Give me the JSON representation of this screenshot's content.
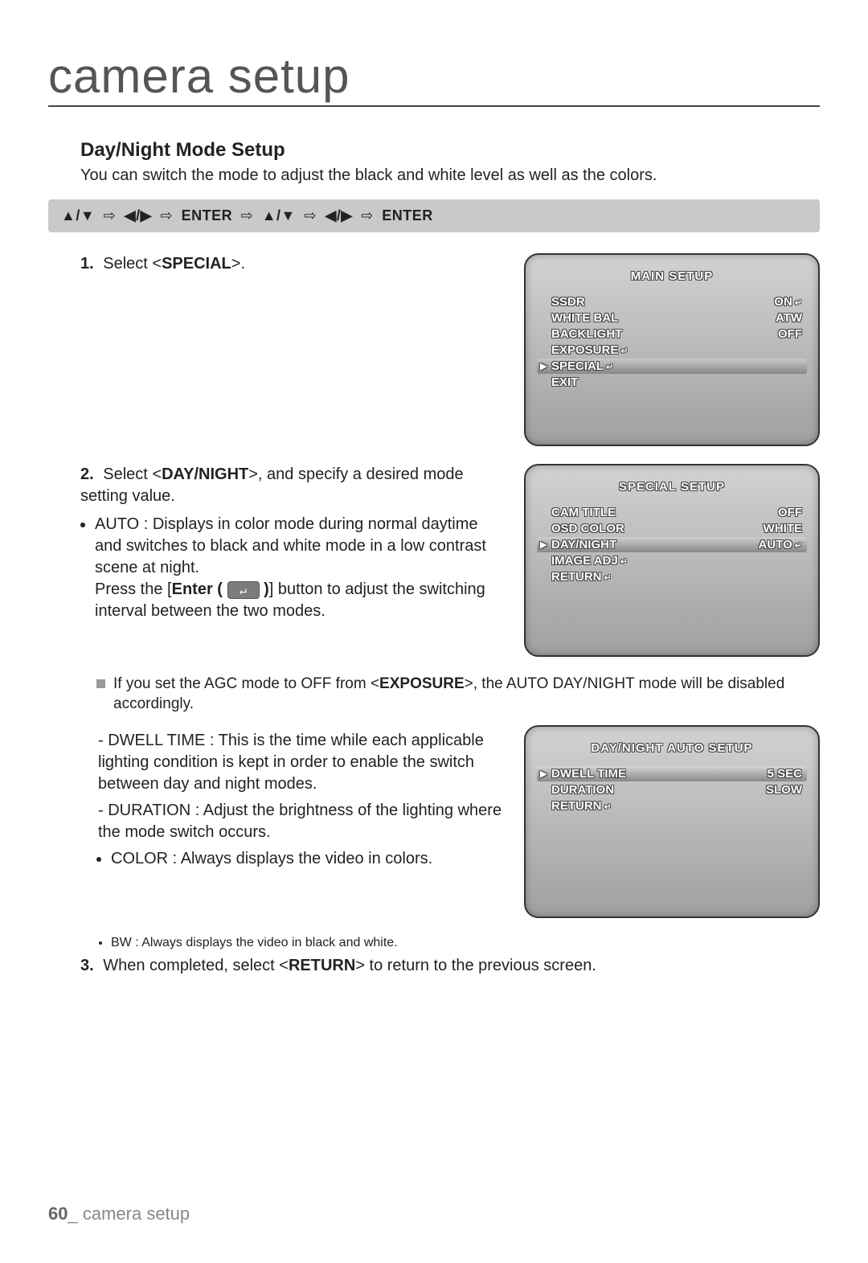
{
  "page_title": "camera setup",
  "heading": "Day/Night Mode Setup",
  "intro": "You can switch the mode to adjust the black and white level as well as the colors.",
  "nav": {
    "seg1": "▲/▼",
    "seg2": "◀/▶",
    "enter": "ENTER",
    "arrow": "⇨"
  },
  "steps": {
    "s1_num": "1.",
    "s1_a": "Select <",
    "s1_b": "SPECIAL",
    "s1_c": ">.",
    "s2_num": "2.",
    "s2_a": "Select <",
    "s2_b": "DAY/NIGHT",
    "s2_c": ">, and specify a desired mode setting value.",
    "auto": "AUTO : Displays in color mode during normal daytime and switches to black and white mode in a low contrast scene at night.",
    "press_a": "Press the [",
    "press_b": "Enter (",
    "press_c": ")",
    "press_d": "] button to adjust the switching interval between the two modes.",
    "note_a": "If you set the AGC mode to OFF from <",
    "note_b": "EXPOSURE",
    "note_c": ">, the AUTO DAY/NIGHT mode will be disabled accordingly.",
    "dwell": "DWELL TIME : This is the time while each applicable lighting condition is kept in order to enable the switch between day and night modes.",
    "duration": "DURATION : Adjust the brightness of the lighting where the mode switch occurs.",
    "color": "COLOR : Always displays the video in colors.",
    "bw": "BW : Always displays the video in black and white.",
    "s3_num": "3.",
    "s3_a": "When completed, select <",
    "s3_b": "RETURN",
    "s3_c": "> to return to the previous screen."
  },
  "osd1": {
    "title": "MAIN SETUP",
    "items": [
      {
        "label": "SSDR",
        "value": "ON",
        "valicon": "↵",
        "sel": false
      },
      {
        "label": "WHITE BAL",
        "value": "ATW",
        "sel": false
      },
      {
        "label": "BACKLIGHT",
        "value": "OFF",
        "sel": false
      },
      {
        "label": "EXPOSURE",
        "icon": "↵",
        "value": "",
        "sel": false
      },
      {
        "label": "SPECIAL",
        "icon": "↵",
        "value": "",
        "sel": true
      },
      {
        "label": "EXIT",
        "value": "",
        "sel": false
      }
    ]
  },
  "osd2": {
    "title": "SPECIAL SETUP",
    "items": [
      {
        "label": "CAM TITLE",
        "value": "OFF",
        "sel": false
      },
      {
        "label": "OSD COLOR",
        "value": "WHITE",
        "sel": false
      },
      {
        "label": "DAY/NIGHT",
        "value": "AUTO",
        "valicon": "↵",
        "sel": true
      },
      {
        "label": "IMAGE ADJ",
        "icon": "↵",
        "value": "",
        "sel": false
      },
      {
        "label": "RETURN",
        "icon": "↵",
        "value": "",
        "sel": false
      }
    ]
  },
  "osd3": {
    "title": "DAY/NIGHT AUTO SETUP",
    "items": [
      {
        "label": "DWELL TIME",
        "value": "5 SEC",
        "sel": true
      },
      {
        "label": "DURATION",
        "value": "SLOW",
        "sel": false
      },
      {
        "label": "RETURN",
        "icon": "↵",
        "value": "",
        "sel": false
      }
    ]
  },
  "footer": {
    "page": "60",
    "sep": "_ ",
    "label": "camera setup"
  }
}
